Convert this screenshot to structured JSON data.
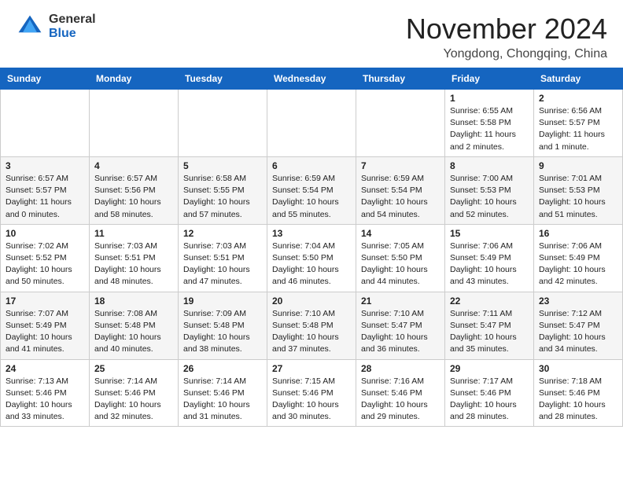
{
  "header": {
    "logo_general": "General",
    "logo_blue": "Blue",
    "month_title": "November 2024",
    "location": "Yongdong, Chongqing, China"
  },
  "calendar": {
    "days_of_week": [
      "Sunday",
      "Monday",
      "Tuesday",
      "Wednesday",
      "Thursday",
      "Friday",
      "Saturday"
    ],
    "weeks": [
      [
        {
          "day": "",
          "info": ""
        },
        {
          "day": "",
          "info": ""
        },
        {
          "day": "",
          "info": ""
        },
        {
          "day": "",
          "info": ""
        },
        {
          "day": "",
          "info": ""
        },
        {
          "day": "1",
          "info": "Sunrise: 6:55 AM\nSunset: 5:58 PM\nDaylight: 11 hours\nand 2 minutes."
        },
        {
          "day": "2",
          "info": "Sunrise: 6:56 AM\nSunset: 5:57 PM\nDaylight: 11 hours\nand 1 minute."
        }
      ],
      [
        {
          "day": "3",
          "info": "Sunrise: 6:57 AM\nSunset: 5:57 PM\nDaylight: 11 hours\nand 0 minutes."
        },
        {
          "day": "4",
          "info": "Sunrise: 6:57 AM\nSunset: 5:56 PM\nDaylight: 10 hours\nand 58 minutes."
        },
        {
          "day": "5",
          "info": "Sunrise: 6:58 AM\nSunset: 5:55 PM\nDaylight: 10 hours\nand 57 minutes."
        },
        {
          "day": "6",
          "info": "Sunrise: 6:59 AM\nSunset: 5:54 PM\nDaylight: 10 hours\nand 55 minutes."
        },
        {
          "day": "7",
          "info": "Sunrise: 6:59 AM\nSunset: 5:54 PM\nDaylight: 10 hours\nand 54 minutes."
        },
        {
          "day": "8",
          "info": "Sunrise: 7:00 AM\nSunset: 5:53 PM\nDaylight: 10 hours\nand 52 minutes."
        },
        {
          "day": "9",
          "info": "Sunrise: 7:01 AM\nSunset: 5:53 PM\nDaylight: 10 hours\nand 51 minutes."
        }
      ],
      [
        {
          "day": "10",
          "info": "Sunrise: 7:02 AM\nSunset: 5:52 PM\nDaylight: 10 hours\nand 50 minutes."
        },
        {
          "day": "11",
          "info": "Sunrise: 7:03 AM\nSunset: 5:51 PM\nDaylight: 10 hours\nand 48 minutes."
        },
        {
          "day": "12",
          "info": "Sunrise: 7:03 AM\nSunset: 5:51 PM\nDaylight: 10 hours\nand 47 minutes."
        },
        {
          "day": "13",
          "info": "Sunrise: 7:04 AM\nSunset: 5:50 PM\nDaylight: 10 hours\nand 46 minutes."
        },
        {
          "day": "14",
          "info": "Sunrise: 7:05 AM\nSunset: 5:50 PM\nDaylight: 10 hours\nand 44 minutes."
        },
        {
          "day": "15",
          "info": "Sunrise: 7:06 AM\nSunset: 5:49 PM\nDaylight: 10 hours\nand 43 minutes."
        },
        {
          "day": "16",
          "info": "Sunrise: 7:06 AM\nSunset: 5:49 PM\nDaylight: 10 hours\nand 42 minutes."
        }
      ],
      [
        {
          "day": "17",
          "info": "Sunrise: 7:07 AM\nSunset: 5:49 PM\nDaylight: 10 hours\nand 41 minutes."
        },
        {
          "day": "18",
          "info": "Sunrise: 7:08 AM\nSunset: 5:48 PM\nDaylight: 10 hours\nand 40 minutes."
        },
        {
          "day": "19",
          "info": "Sunrise: 7:09 AM\nSunset: 5:48 PM\nDaylight: 10 hours\nand 38 minutes."
        },
        {
          "day": "20",
          "info": "Sunrise: 7:10 AM\nSunset: 5:48 PM\nDaylight: 10 hours\nand 37 minutes."
        },
        {
          "day": "21",
          "info": "Sunrise: 7:10 AM\nSunset: 5:47 PM\nDaylight: 10 hours\nand 36 minutes."
        },
        {
          "day": "22",
          "info": "Sunrise: 7:11 AM\nSunset: 5:47 PM\nDaylight: 10 hours\nand 35 minutes."
        },
        {
          "day": "23",
          "info": "Sunrise: 7:12 AM\nSunset: 5:47 PM\nDaylight: 10 hours\nand 34 minutes."
        }
      ],
      [
        {
          "day": "24",
          "info": "Sunrise: 7:13 AM\nSunset: 5:46 PM\nDaylight: 10 hours\nand 33 minutes."
        },
        {
          "day": "25",
          "info": "Sunrise: 7:14 AM\nSunset: 5:46 PM\nDaylight: 10 hours\nand 32 minutes."
        },
        {
          "day": "26",
          "info": "Sunrise: 7:14 AM\nSunset: 5:46 PM\nDaylight: 10 hours\nand 31 minutes."
        },
        {
          "day": "27",
          "info": "Sunrise: 7:15 AM\nSunset: 5:46 PM\nDaylight: 10 hours\nand 30 minutes."
        },
        {
          "day": "28",
          "info": "Sunrise: 7:16 AM\nSunset: 5:46 PM\nDaylight: 10 hours\nand 29 minutes."
        },
        {
          "day": "29",
          "info": "Sunrise: 7:17 AM\nSunset: 5:46 PM\nDaylight: 10 hours\nand 28 minutes."
        },
        {
          "day": "30",
          "info": "Sunrise: 7:18 AM\nSunset: 5:46 PM\nDaylight: 10 hours\nand 28 minutes."
        }
      ]
    ]
  }
}
